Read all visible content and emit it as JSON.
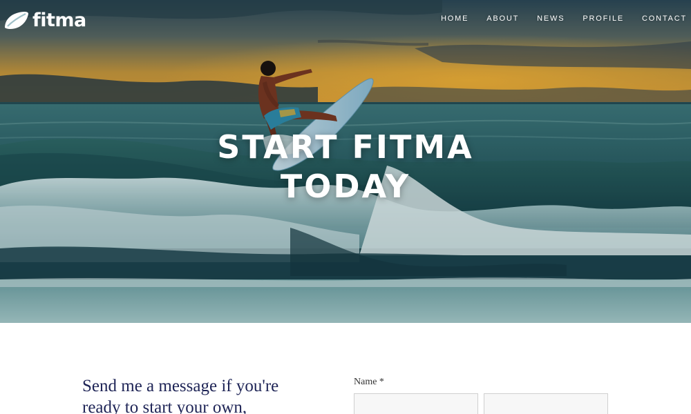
{
  "header": {
    "logo_text": "fitma",
    "nav": [
      {
        "label": "HOME"
      },
      {
        "label": "ABOUT"
      },
      {
        "label": "NEWS"
      },
      {
        "label": "PROFILE"
      },
      {
        "label": "CONTACT"
      }
    ]
  },
  "hero": {
    "headline_line1": "START FITMA",
    "headline_line2": "TODAY"
  },
  "contact": {
    "intro": "Send me a message if you're ready to start your own,",
    "name_label": "Name *",
    "first_name_value": "",
    "last_name_value": ""
  },
  "colors": {
    "intro_text": "#1e2456",
    "field_background": "#f7f7f7",
    "field_border": "#cfcfcf"
  }
}
